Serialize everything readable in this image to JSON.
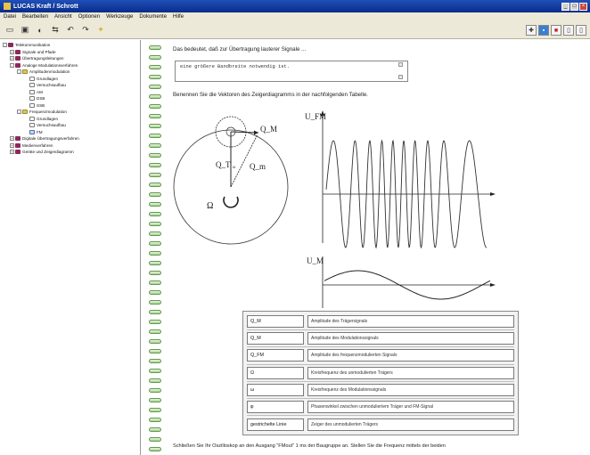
{
  "window": {
    "title": "LUCAS Kraft / Schrott"
  },
  "menubar": [
    "Datei",
    "Bearbeiten",
    "Ansicht",
    "Optionen",
    "Werkzeuge",
    "Dokumente",
    "Hilfe"
  ],
  "toolbar": {
    "left_icons": [
      "open-icon",
      "save-icon",
      "back-icon",
      "forward-icon",
      "undo-icon",
      "redo-icon",
      "bookmark-icon"
    ],
    "right_icons": [
      "print-icon",
      "monitor-icon",
      "slide-icon",
      "page-icon",
      "page2-icon"
    ]
  },
  "tree": [
    {
      "level": 0,
      "icon": "book",
      "label": "Telekommunikation",
      "exp": "-"
    },
    {
      "level": 1,
      "icon": "book",
      "label": "Signale und Pfade",
      "exp": "+"
    },
    {
      "level": 1,
      "icon": "book",
      "label": "Übertragungsleitungen",
      "exp": "+"
    },
    {
      "level": 1,
      "icon": "book",
      "label": "Analoge Modulationsverfahren",
      "exp": "-"
    },
    {
      "level": 2,
      "icon": "folder",
      "label": "Amplitudenmodulation",
      "exp": "-"
    },
    {
      "level": 3,
      "icon": "page",
      "label": "Grundlagen"
    },
    {
      "level": 3,
      "icon": "page",
      "label": "Versuchsaufbau"
    },
    {
      "level": 3,
      "icon": "page",
      "label": "AM"
    },
    {
      "level": 3,
      "icon": "page",
      "label": "DSB"
    },
    {
      "level": 3,
      "icon": "page",
      "label": "SSB"
    },
    {
      "level": 2,
      "icon": "folder",
      "label": "Frequenzmodulation",
      "exp": "-"
    },
    {
      "level": 3,
      "icon": "page",
      "label": "Grundlagen"
    },
    {
      "level": 3,
      "icon": "page",
      "label": "Versuchsaufbau"
    },
    {
      "level": 3,
      "icon": "pagesel",
      "label": "FM"
    },
    {
      "level": 1,
      "icon": "book",
      "label": "Digitale Übertragungsverfahren",
      "exp": "+"
    },
    {
      "level": 1,
      "icon": "book",
      "label": "Medienverfahren",
      "exp": "+"
    },
    {
      "level": 1,
      "icon": "book",
      "label": "Geräte und Zeigerdiagramm",
      "exp": "+"
    }
  ],
  "content": {
    "intro": "Das bedeutet, daß zur Übertragung lauterer Signale ...",
    "answer_value": "eine größere Bandbreite notwendig ist.",
    "instruction": "Benennen Sie die Vektoren des Zeigerdiagramms in der nachfolgenden Tabelle.",
    "bottom": "Schließen Sie Ihr Oszilloskop an den Ausgang \"FMout\" 1 ms der Baugruppe an. Stellen Sie die Frequenz mittels der beiden"
  },
  "diagram": {
    "labels": {
      "big_circle": "Ω",
      "top": "Q_M",
      "left": "Q_T",
      "right": "Q_m",
      "inner": "ω"
    }
  },
  "chart_data": [
    {
      "type": "line",
      "ylabel": "U_FM",
      "series": [
        {
          "name": "",
          "form": "frequency-modulated carrier"
        }
      ]
    },
    {
      "type": "line",
      "ylabel": "U_M",
      "series": [
        {
          "name": "",
          "form": "sine"
        }
      ]
    }
  ],
  "table": {
    "rows": [
      {
        "sym": "Q_M",
        "ans": "Amplitude des Trägersignals"
      },
      {
        "sym": "Q_M",
        "ans": "Amplitude des Modulationssignals"
      },
      {
        "sym": "Q_FM",
        "ans": "Amplitude des frequenzmodulierten Signals"
      },
      {
        "sym": "Ω",
        "ans": "Kreisfrequenz des unmodulierten Trägers"
      },
      {
        "sym": "ω",
        "ans": "Kreisfrequenz des Modulationssignals"
      },
      {
        "sym": "φ",
        "ans": "Phasenwinkel zwischen unmoduliertem Träger und FM-Signal"
      },
      {
        "sym": "gestrichelte Linie",
        "ans": "Zeiger des unmodulierten Trägers"
      }
    ]
  }
}
